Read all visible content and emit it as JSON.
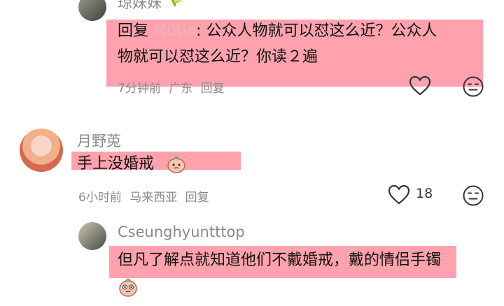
{
  "comment1": {
    "username": "琼妹妹",
    "reply_label": "回复",
    "mention": "Mutio",
    "text_line1": ": 公众人物就可以怼这么近？公众人",
    "text_line2": "物就可以怼这么近？你读２遍",
    "time": "7分钟前",
    "location": "广东",
    "reply_button": "回复"
  },
  "comment2": {
    "username": "月野莵",
    "text": "手上没婚戒",
    "time": "6小时前",
    "location": "马来西亚",
    "reply_button": "回复",
    "like_count": "18"
  },
  "comment3": {
    "username": "Cseunghyuntttop",
    "text_line1": "但凡了解点就知道他们不戴婚戒，戴的情侣手镯"
  },
  "colors": {
    "highlight": "#ff697d",
    "meta_text": "#8a8a8a"
  },
  "icons": [
    "heart-outline-icon",
    "dislike-face-icon",
    "sticker-emoji-icon",
    "wheat-emoji-icon"
  ]
}
